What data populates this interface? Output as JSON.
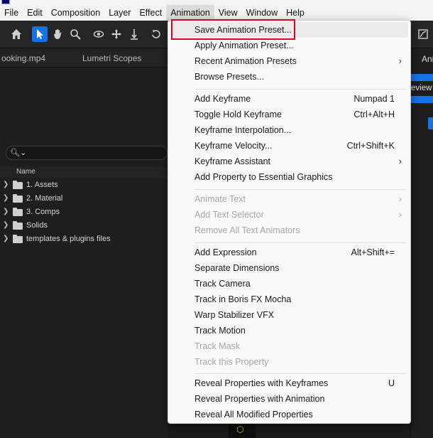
{
  "menubar": [
    "File",
    "Edit",
    "Composition",
    "Layer",
    "Effect",
    "Animation",
    "View",
    "Window",
    "Help"
  ],
  "left_panel": {
    "tabs": [
      "ooking.mp4",
      "Lumetri Scopes"
    ],
    "search_icon": "search-icon",
    "column_header": "Name",
    "folders": [
      "1. Assets",
      "2. Material",
      "3. Comps",
      "Solids",
      "templates & plugins files"
    ]
  },
  "right_panel": {
    "tab": "Ani",
    "text": "eview"
  },
  "animation_menu": {
    "group1": [
      {
        "label": "Save Animation Preset...",
        "shortcut": "",
        "submenu": false,
        "enabled": true
      },
      {
        "label": "Apply Animation Preset...",
        "shortcut": "",
        "submenu": false,
        "enabled": true
      },
      {
        "label": "Recent Animation Presets",
        "shortcut": "",
        "submenu": true,
        "enabled": true
      },
      {
        "label": "Browse Presets...",
        "shortcut": "",
        "submenu": false,
        "enabled": true
      }
    ],
    "group2": [
      {
        "label": "Add Keyframe",
        "shortcut": "Numpad 1",
        "submenu": false,
        "enabled": true
      },
      {
        "label": "Toggle Hold Keyframe",
        "shortcut": "Ctrl+Alt+H",
        "submenu": false,
        "enabled": true
      },
      {
        "label": "Keyframe Interpolation...",
        "shortcut": "",
        "submenu": false,
        "enabled": true
      },
      {
        "label": "Keyframe Velocity...",
        "shortcut": "Ctrl+Shift+K",
        "submenu": false,
        "enabled": true
      },
      {
        "label": "Keyframe Assistant",
        "shortcut": "",
        "submenu": true,
        "enabled": true
      },
      {
        "label": "Add Property to Essential Graphics",
        "shortcut": "",
        "submenu": false,
        "enabled": true
      }
    ],
    "group3": [
      {
        "label": "Animate Text",
        "shortcut": "",
        "submenu": true,
        "enabled": false
      },
      {
        "label": "Add Text Selector",
        "shortcut": "",
        "submenu": true,
        "enabled": false
      },
      {
        "label": "Remove All Text Animators",
        "shortcut": "",
        "submenu": false,
        "enabled": false
      }
    ],
    "group4": [
      {
        "label": "Add Expression",
        "shortcut": "Alt+Shift+=",
        "submenu": false,
        "enabled": true
      },
      {
        "label": "Separate Dimensions",
        "shortcut": "",
        "submenu": false,
        "enabled": true
      },
      {
        "label": "Track Camera",
        "shortcut": "",
        "submenu": false,
        "enabled": true
      },
      {
        "label": "Track in Boris FX Mocha",
        "shortcut": "",
        "submenu": false,
        "enabled": true
      },
      {
        "label": "Warp Stabilizer VFX",
        "shortcut": "",
        "submenu": false,
        "enabled": true
      },
      {
        "label": "Track Motion",
        "shortcut": "",
        "submenu": false,
        "enabled": true
      },
      {
        "label": "Track Mask",
        "shortcut": "",
        "submenu": false,
        "enabled": false
      },
      {
        "label": "Track this Property",
        "shortcut": "",
        "submenu": false,
        "enabled": false
      }
    ],
    "group5": [
      {
        "label": "Reveal Properties with Keyframes",
        "shortcut": "U",
        "submenu": false,
        "enabled": true
      },
      {
        "label": "Reveal Properties with Animation",
        "shortcut": "",
        "submenu": false,
        "enabled": true
      },
      {
        "label": "Reveal All Modified Properties",
        "shortcut": "",
        "submenu": false,
        "enabled": true
      }
    ]
  },
  "colors": {
    "accent": "#1473e6",
    "highlight_box": "#e3001b",
    "menu_bg": "#f9f9f9",
    "panel_bg": "#1e1e1e"
  }
}
